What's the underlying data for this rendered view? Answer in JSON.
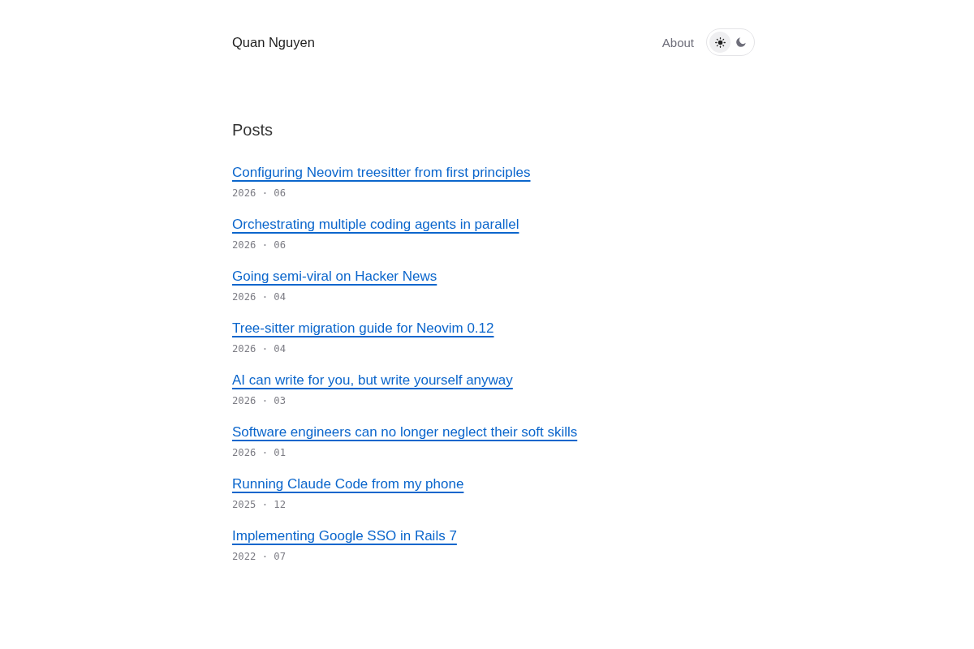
{
  "header": {
    "site_title": "Quan Nguyen",
    "nav": [
      {
        "label": "About"
      }
    ],
    "theme_toggle": [
      {
        "kind": "sun",
        "selected": true
      },
      {
        "kind": "moon",
        "selected": false
      }
    ]
  },
  "posts": {
    "heading": "Posts",
    "items": [
      {
        "title": "Configuring Neovim treesitter from first principles",
        "date": "2026 · 06"
      },
      {
        "title": "Orchestrating multiple coding agents in parallel",
        "date": "2026 · 06"
      },
      {
        "title": "Going semi-viral on Hacker News",
        "date": "2026 · 04"
      },
      {
        "title": "Tree-sitter migration guide for Neovim 0.12",
        "date": "2026 · 04"
      },
      {
        "title": "AI can write for you, but write yourself anyway",
        "date": "2026 · 03"
      },
      {
        "title": "Software engineers can no longer neglect their soft skills",
        "date": "2026 · 01"
      },
      {
        "title": "Running Claude Code from my phone",
        "date": "2025 · 12"
      },
      {
        "title": "Implementing Google SSO in Rails 7",
        "date": "2022 · 07"
      }
    ]
  }
}
